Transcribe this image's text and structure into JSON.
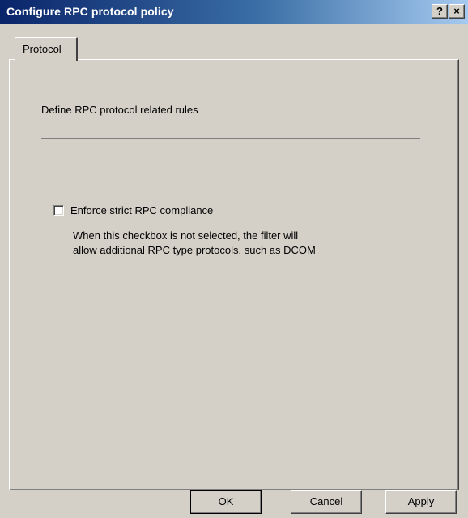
{
  "window": {
    "title": "Configure RPC protocol policy",
    "help_label": "?",
    "close_label": "×"
  },
  "tabs": [
    {
      "label": "Protocol",
      "selected": true
    }
  ],
  "content": {
    "description": "Define RPC protocol related rules",
    "checkbox": {
      "label": "Enforce strict RPC compliance",
      "checked": false
    },
    "help_lines": [
      "When this checkbox is not selected, the filter will",
      "allow additional RPC type protocols, such as DCOM"
    ]
  },
  "buttons": {
    "ok": "OK",
    "cancel": "Cancel",
    "apply": "Apply"
  },
  "colors": {
    "title_bar_start": "#0a246a",
    "title_bar_end": "#a6caf0",
    "dialog_face": "#d4d0c8"
  }
}
